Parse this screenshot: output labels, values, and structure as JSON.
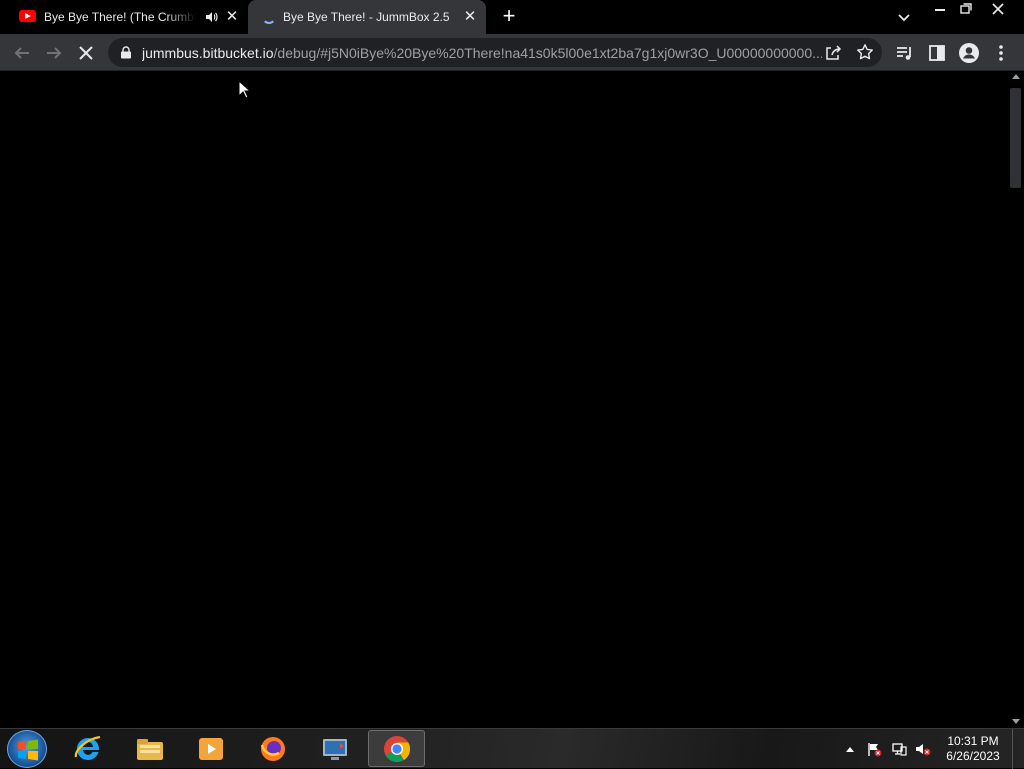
{
  "browser": {
    "tabs": [
      {
        "title": "Bye Bye There! (The Crumbling",
        "favicon": "youtube-icon",
        "audio": true
      },
      {
        "title": "Bye Bye There! - JummBox 2.5",
        "favicon": "loading-spinner-icon",
        "active": true
      }
    ],
    "new_tab_label": "+",
    "address_host": "jummbus.bitbucket.io",
    "address_rest": "/debug/#j5N0iBye%20Bye%20There!na41s0k5l00e1xt2ba7g1xj0wr3O_U00000000000...",
    "accent_color": "#8ab4f8"
  },
  "taskbar": {
    "pinned": [
      "internet-explorer-icon",
      "windows-explorer-icon",
      "media-player-icon",
      "firefox-icon",
      "remote-desktop-icon",
      "chrome-icon"
    ],
    "active_app": "chrome-icon",
    "time": "10:31 PM",
    "date": "6/26/2023"
  }
}
